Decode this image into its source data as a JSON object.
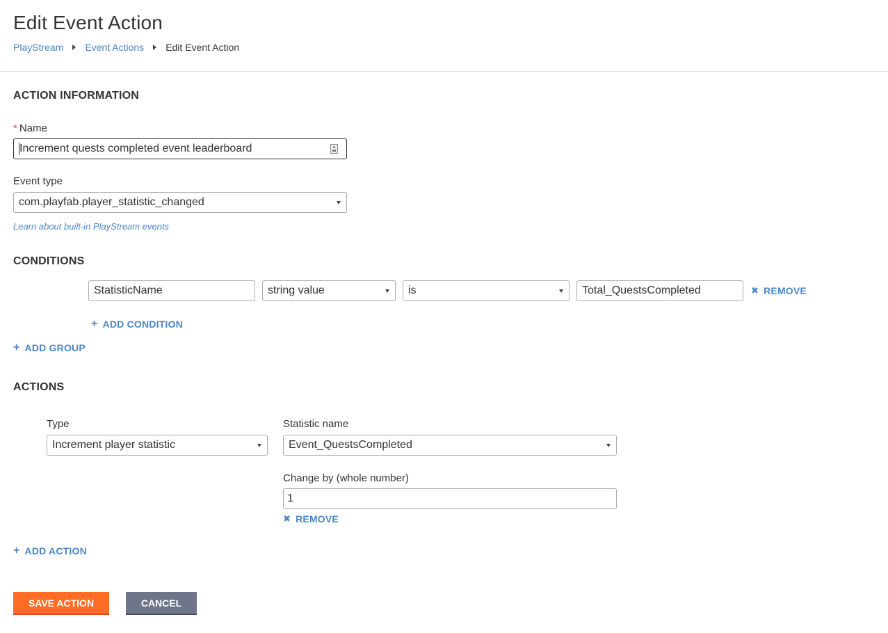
{
  "header": {
    "title": "Edit Event Action",
    "breadcrumb": [
      {
        "label": "PlayStream",
        "link": true
      },
      {
        "label": "Event Actions",
        "link": true
      },
      {
        "label": "Edit Event Action",
        "link": false
      }
    ]
  },
  "action_information": {
    "section_title": "ACTION INFORMATION",
    "name_label": "Name",
    "name_required_marker": "*",
    "name_value": "Increment quests completed event leaderboard",
    "event_type_label": "Event type",
    "event_type_value": "com.playfab.player_statistic_changed",
    "help_link": "Learn about built-in PlayStream events"
  },
  "conditions": {
    "section_title": "CONDITIONS",
    "rows": [
      {
        "field": "StatisticName",
        "value_type": "string value",
        "operator": "is",
        "value": "Total_QuestsCompleted",
        "remove_label": "REMOVE"
      }
    ],
    "add_condition_label": "ADD CONDITION",
    "add_group_label": "ADD GROUP"
  },
  "actions": {
    "section_title": "ACTIONS",
    "type_label": "Type",
    "type_value": "Increment player statistic",
    "statistic_name_label": "Statistic name",
    "statistic_name_value": "Event_QuestsCompleted",
    "change_by_label": "Change by (whole number)",
    "change_by_value": "1",
    "remove_label": "REMOVE",
    "add_action_label": "ADD ACTION"
  },
  "footer": {
    "save_label": "SAVE ACTION",
    "cancel_label": "CANCEL"
  },
  "icons": {
    "plus": "+",
    "remove": "✖"
  },
  "colors": {
    "link": "#4a86c8",
    "required": "#e8386d",
    "save": "#ff6d24",
    "cancel": "#6f7588"
  }
}
